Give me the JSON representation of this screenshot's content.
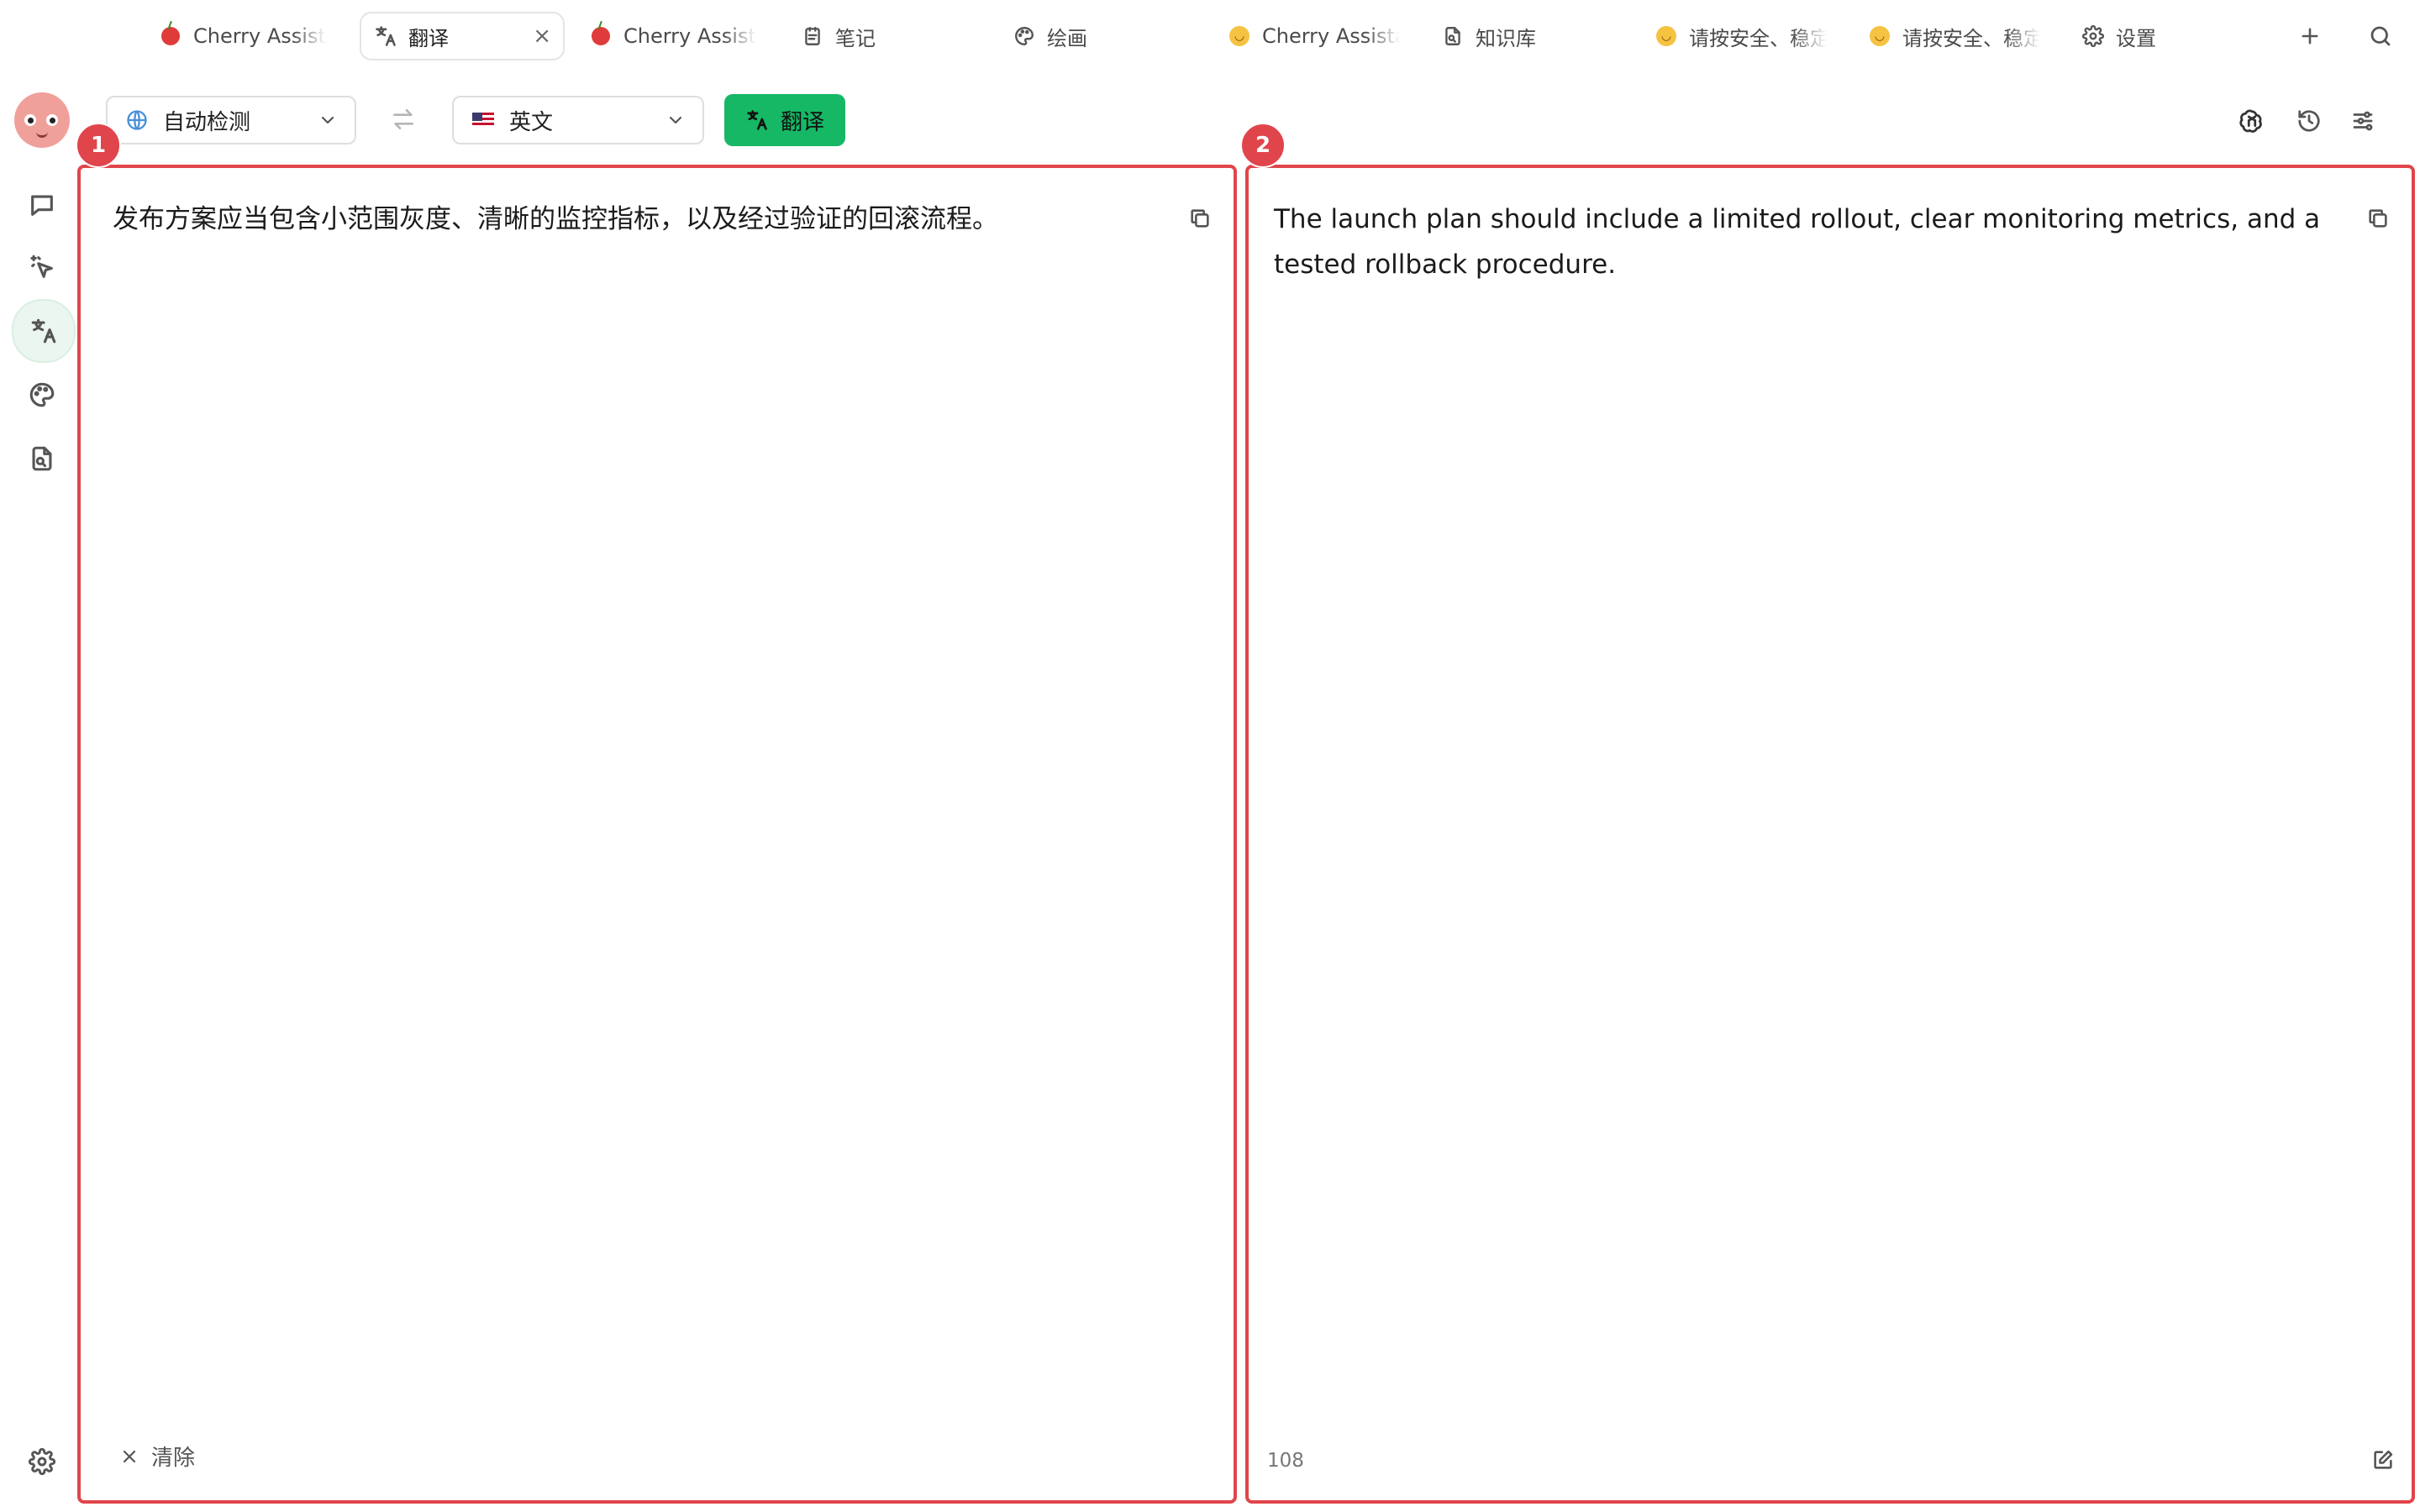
{
  "tabs": [
    {
      "label": "Cherry Assistant",
      "icon": "cherry-icon",
      "active": false
    },
    {
      "label": "翻译",
      "icon": "translate-icon",
      "active": true,
      "close": "×"
    },
    {
      "label": "Cherry Assistant",
      "icon": "cherry-icon",
      "active": false
    },
    {
      "label": "笔记",
      "icon": "notes-icon",
      "active": false
    },
    {
      "label": "绘画",
      "icon": "palette-icon",
      "active": false
    },
    {
      "label": "Cherry Assistant",
      "icon": "smile-emoji-icon",
      "active": false
    },
    {
      "label": "知识库",
      "icon": "knowledge-icon",
      "active": false
    },
    {
      "label": "请按安全、稳定",
      "icon": "smile-emoji-icon",
      "active": false
    },
    {
      "label": "请按安全、稳定",
      "icon": "smile-emoji-icon",
      "active": false
    },
    {
      "label": "设置",
      "icon": "gear-icon",
      "active": false
    }
  ],
  "rail": {
    "items": [
      "chat-icon",
      "cursor-sparkle-icon",
      "translate-icon",
      "palette-icon",
      "file-search-icon"
    ],
    "active": "translate-icon",
    "bottom": "gear-icon"
  },
  "toolbar": {
    "source_lang": "自动检测",
    "target_lang": "英文",
    "translate_label": "翻译"
  },
  "source": {
    "badge": "1",
    "text": "发布方案应当包含小范围灰度、清晰的监控指标，以及经过验证的回滚流程。",
    "clear_label": "清除"
  },
  "target": {
    "badge": "2",
    "text": "The launch plan should include a limited rollout, clear monitoring metrics, and a tested rollback procedure.",
    "char_count": "108"
  },
  "colors": {
    "accent_green": "#16b865",
    "annotation_red": "#e0454b"
  }
}
